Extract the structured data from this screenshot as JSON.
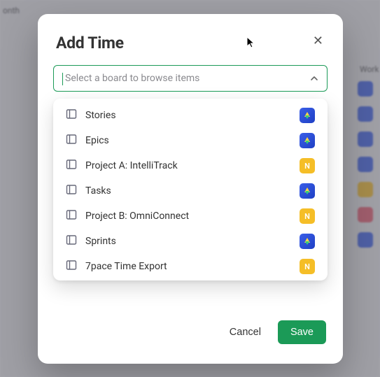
{
  "modal": {
    "title": "Add Time",
    "close": "✕"
  },
  "select": {
    "placeholder": "Select a board to browse items"
  },
  "options": [
    {
      "label": "Stories",
      "icon": "blue"
    },
    {
      "label": "Epics",
      "icon": "blue"
    },
    {
      "label": "Project A: IntelliTrack",
      "icon": "yellow"
    },
    {
      "label": "Tasks",
      "icon": "blue"
    },
    {
      "label": "Project B: OmniConnect",
      "icon": "yellow"
    },
    {
      "label": "Sprints",
      "icon": "blue"
    },
    {
      "label": "7pace Time Export",
      "icon": "yellow"
    }
  ],
  "footer": {
    "cancel": "Cancel",
    "save": "Save"
  },
  "bg": {
    "month": "onth",
    "work": "Work"
  },
  "icon_letter": "N"
}
